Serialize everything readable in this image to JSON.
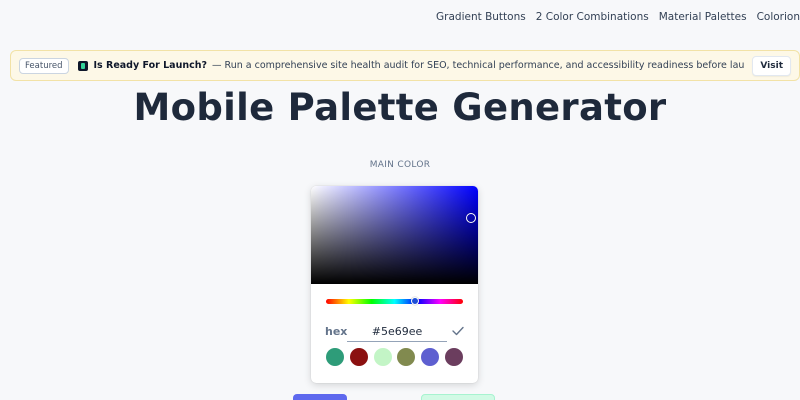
{
  "nav": {
    "items": [
      "Gradient Buttons",
      "2 Color Combinations",
      "Material Palettes",
      "Colorion"
    ]
  },
  "banner": {
    "badge": "Featured",
    "product_icon": "product-logo-icon",
    "title": "Is Ready For Launch?",
    "description": "— Run a comprehensive site health audit for SEO, technical performance, and accessibility readiness before launch.",
    "visit_label": "Visit"
  },
  "page": {
    "title": "Mobile Palette Generator",
    "section_label": "MAIN COLOR"
  },
  "picker": {
    "hex_label": "hex",
    "hex_value": "#5e69ee",
    "confirm_icon": "check-icon",
    "hue_color": "#0000ff",
    "swatches": [
      "#2e9c79",
      "#8b1010",
      "#c3f5c6",
      "#818a4f",
      "#5e5fd0",
      "#6b3d5e"
    ]
  },
  "colors": {
    "primary_button": "#5e69ee",
    "secondary_button": "#d1fae5"
  }
}
